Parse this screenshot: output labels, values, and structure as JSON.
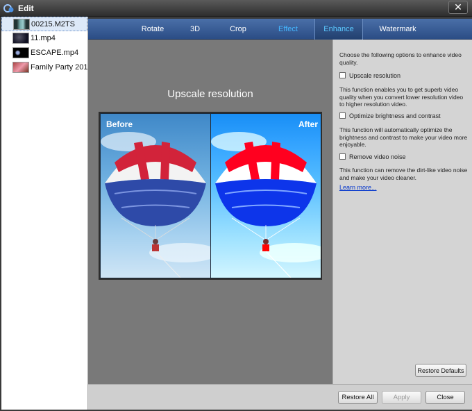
{
  "window": {
    "title": "Edit"
  },
  "files": [
    {
      "name": "00215.M2TS",
      "selected": true
    },
    {
      "name": "11.mp4",
      "selected": false
    },
    {
      "name": "ESCAPE.mp4",
      "selected": false
    },
    {
      "name": "Family Party 201...",
      "selected": false
    }
  ],
  "tabs": [
    {
      "label": "Rotate",
      "state": "normal"
    },
    {
      "label": "3D",
      "state": "normal"
    },
    {
      "label": "Crop",
      "state": "normal"
    },
    {
      "label": "Effect",
      "state": "dim"
    },
    {
      "label": "Enhance",
      "state": "active"
    },
    {
      "label": "Watermark",
      "state": "normal"
    }
  ],
  "preview": {
    "title": "Upscale resolution",
    "before_label": "Before",
    "after_label": "After"
  },
  "options": {
    "intro": "Choose the following options to enhance video quality.",
    "items": [
      {
        "label": "Upscale resolution",
        "checked": false,
        "description": "This function enables you to get superb video quality when you convert lower resolution video to higher resolution video."
      },
      {
        "label": "Optimize brightness and contrast",
        "checked": false,
        "description": "This function will automatically optimize the brightness and contrast to make your video more enjoyable."
      },
      {
        "label": "Remove video noise",
        "checked": false,
        "description": "This function can remove the dirt-like video noise and make your video cleaner."
      }
    ],
    "learn_more": "Learn more...",
    "restore_defaults": "Restore Defaults"
  },
  "footer": {
    "restore_all": "Restore All",
    "apply": "Apply",
    "close": "Close"
  },
  "colors": {
    "tab_bar": "#2b4d85",
    "active_tab_text": "#5bc8ff",
    "link": "#0033cc"
  }
}
